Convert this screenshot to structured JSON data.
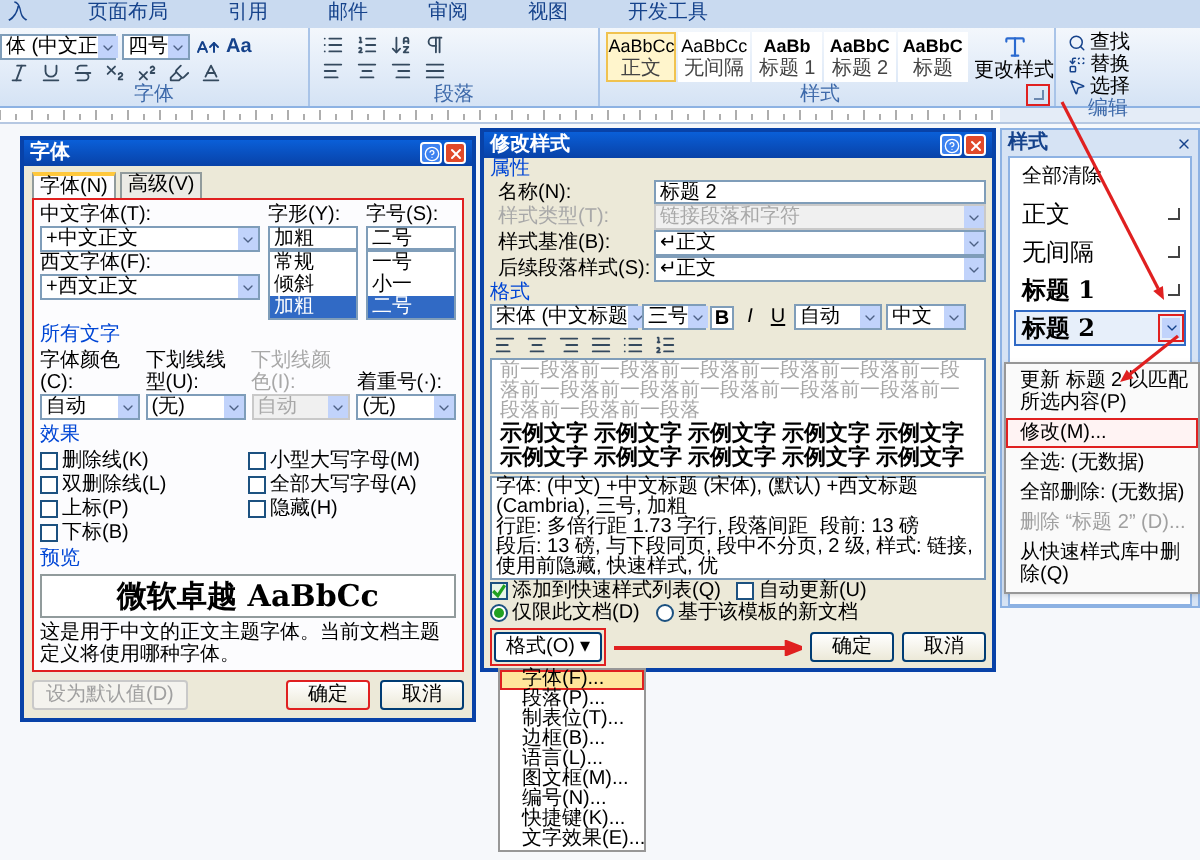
{
  "ribbon": {
    "tabs": [
      {
        "label": "入",
        "selected": false
      },
      {
        "label": "页面布局",
        "selected": false
      },
      {
        "label": "引用",
        "selected": false
      },
      {
        "label": "邮件",
        "selected": false
      },
      {
        "label": "审阅",
        "selected": false
      },
      {
        "label": "视图",
        "selected": false
      },
      {
        "label": "开发工具",
        "selected": false
      }
    ],
    "font_name": "体 (中文正",
    "font_size": "四号",
    "case_button": "Aa",
    "groups": [
      "字体",
      "段落",
      "样式",
      "编辑"
    ],
    "styles": [
      {
        "preview": "AaBbCc",
        "label": "正文",
        "selected": true
      },
      {
        "preview": "AaBbCc",
        "label": "无间隔",
        "selected": false
      },
      {
        "preview": "AaBb",
        "label": "标题 1",
        "selected": false
      },
      {
        "preview": "AaBbC",
        "label": "标题 2",
        "selected": false
      },
      {
        "preview": "AaBbC",
        "label": "标题",
        "selected": false
      }
    ],
    "change_styles": "更改样式",
    "edit_commands": [
      "查找",
      "替换",
      "选择"
    ]
  },
  "font_dialog": {
    "title": "字体",
    "tabs": [
      {
        "label": "字体(N)",
        "selected": true
      },
      {
        "label": "高级(V)",
        "selected": false
      }
    ],
    "cn_font_label": "中文字体(T):",
    "cn_font": "+中文正文",
    "west_font_label": "西文字体(F):",
    "west_font": "+西文正文",
    "style_label": "字形(Y):",
    "style_value": "加粗",
    "style_options": [
      {
        "label": "常规",
        "selected": false
      },
      {
        "label": "倾斜",
        "selected": false
      },
      {
        "label": "加粗",
        "selected": true
      }
    ],
    "size_label": "字号(S):",
    "size_value": "二号",
    "size_options": [
      {
        "label": "一号",
        "selected": false
      },
      {
        "label": "小一",
        "selected": false
      },
      {
        "label": "二号",
        "selected": true
      }
    ],
    "all_text_heading": "所有文字",
    "all_text_fields": [
      {
        "label": "字体颜色(C):",
        "value": "自动",
        "disabled": false
      },
      {
        "label": "下划线线型(U):",
        "value": "(无)",
        "disabled": false
      },
      {
        "label": "下划线颜色(I):",
        "value": "自动",
        "disabled": true
      },
      {
        "label": "着重号(·):",
        "value": "(无)",
        "disabled": false
      }
    ],
    "effects_heading": "效果",
    "effects": [
      {
        "label": "删除线(K)",
        "checked": false
      },
      {
        "label": "双删除线(L)",
        "checked": false
      },
      {
        "label": "上标(P)",
        "checked": false
      },
      {
        "label": "下标(B)",
        "checked": false
      },
      {
        "label": "小型大写字母(M)",
        "checked": false
      },
      {
        "label": "全部大写字母(A)",
        "checked": false
      },
      {
        "label": "隐藏(H)",
        "checked": false
      }
    ],
    "preview_heading": "预览",
    "preview_text": "微软卓越 AaBbCc",
    "description": "这是用于中文的正文主题字体。当前文档主题定义将使用哪种字体。",
    "buttons": [
      {
        "label": "设为默认值(D)",
        "disabled": true
      },
      {
        "label": "确定",
        "disabled": false
      },
      {
        "label": "取消",
        "disabled": false
      }
    ]
  },
  "modify_dialog": {
    "title": "修改样式",
    "properties_heading": "属性",
    "properties": [
      {
        "label": "名称(N):",
        "value": "标题 2",
        "disabled": false
      },
      {
        "label": "样式类型(T):",
        "value": "链接段落和字符",
        "disabled": true
      },
      {
        "label": "样式基准(B):",
        "value": "↵正文",
        "disabled": false
      },
      {
        "label": "后续段落样式(S):",
        "value": "↵正文",
        "disabled": false
      }
    ],
    "format_heading": "格式",
    "font": "宋体 (中文标题",
    "size": "三号",
    "bold": "B",
    "italic": "I",
    "underline": "U",
    "color_select": "自动",
    "language": "中文",
    "preceding_text": "前一段落前一段落前一段落前一段落前一段落前一段落前一段落前一段落前一段落前一段落前一段落前一段落前一段落前一段落",
    "sample_lines": [
      "示例文字 示例文字 示例文字 示例文字 示例文字",
      "示例文字 示例文字 示例文字 示例文字 示例文字"
    ],
    "description": [
      "字体: (中文) +中文标题 (宋体), (默认) +西文标题 (Cambria), 三号, 加粗",
      "行距: 多倍行距 1.73 字行, 段落间距",
      "段前: 13 磅",
      "段后: 13 磅, 与下段同页, 段中不分页, 2 级, 样式: 链接, 使用前隐藏, 快速样式, 优"
    ],
    "checks": [
      {
        "label": "添加到快速样式列表(Q)",
        "checked": true
      },
      {
        "label": "自动更新(U)",
        "checked": false
      }
    ],
    "radios": [
      {
        "label": "仅限此文档(D)",
        "selected": true
      },
      {
        "label": "基于该模板的新文档",
        "selected": false
      }
    ],
    "format_button": "格式(O) ▾",
    "buttons": [
      "确定",
      "取消"
    ]
  },
  "styles_pane": {
    "title": "样式",
    "items": [
      {
        "label": "全部清除",
        "kind": "clear",
        "selected": false
      },
      {
        "label": "正文",
        "kind": "paragraph",
        "selected": false
      },
      {
        "label": "无间隔",
        "kind": "paragraph",
        "selected": false
      },
      {
        "label": "标题 1",
        "kind": "linked",
        "selected": false
      },
      {
        "label": "标题 2",
        "kind": "linked",
        "selected": true
      }
    ]
  },
  "context_menu": {
    "items": [
      {
        "label": "更新 标题 2 以匹配所选内容(P)",
        "disabled": false,
        "selected": false
      },
      {
        "label": "修改(M)...",
        "disabled": false,
        "selected": true
      },
      {
        "label": "全选: (无数据)",
        "disabled": false,
        "selected": false
      },
      {
        "label": "全部删除: (无数据)",
        "disabled": false,
        "selected": false
      },
      {
        "label": "删除 “标题 2” (D)...",
        "disabled": true,
        "selected": false
      },
      {
        "label": "从快速样式库中删除(Q)",
        "disabled": false,
        "selected": false
      }
    ]
  },
  "format_menu": {
    "items": [
      {
        "label": "字体(F)...",
        "selected": true
      },
      {
        "label": "段落(P)...",
        "selected": false
      },
      {
        "label": "制表位(T)...",
        "selected": false
      },
      {
        "label": "边框(B)...",
        "selected": false
      },
      {
        "label": "语言(L)...",
        "selected": false
      },
      {
        "label": "图文框(M)...",
        "selected": false
      },
      {
        "label": "编号(N)...",
        "selected": false
      },
      {
        "label": "快捷键(K)...",
        "selected": false
      },
      {
        "label": "文字效果(E)...",
        "selected": false
      }
    ]
  }
}
